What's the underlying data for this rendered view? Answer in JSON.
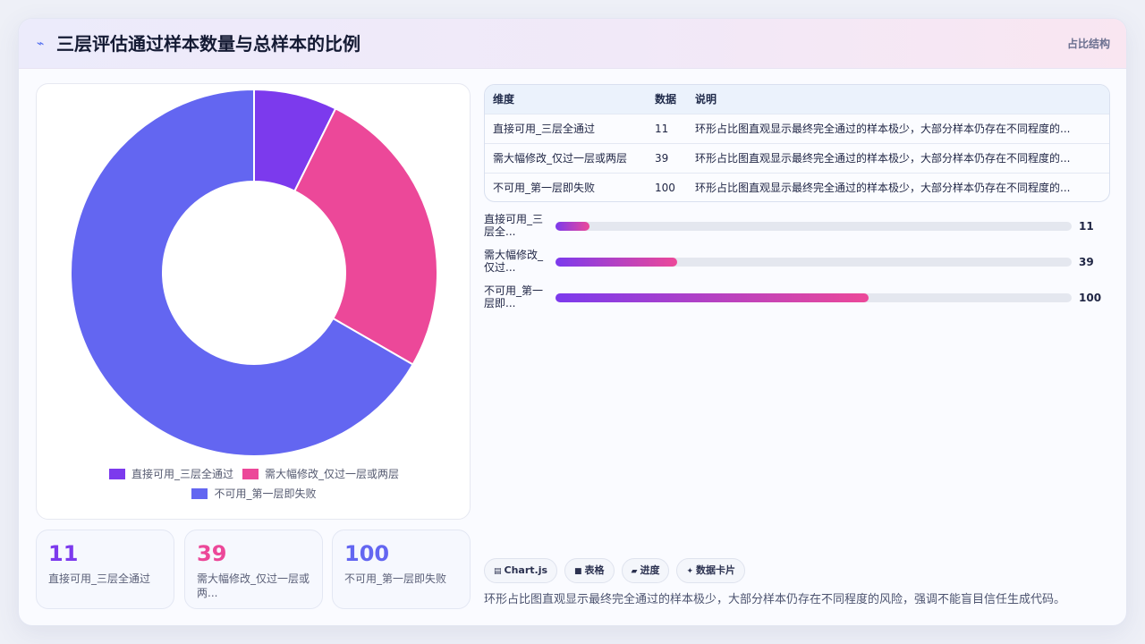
{
  "header": {
    "icon": "sparkle-line-icon",
    "title": "三层评估通过样本数量与总样本的比例",
    "tag": "占比结构"
  },
  "chart_data": {
    "type": "pie",
    "variant": "doughnut",
    "categories": [
      "直接可用_三层全通过",
      "需大幅修改_仅过一层或两层",
      "不可用_第一层即失败"
    ],
    "values": [
      11,
      39,
      100
    ],
    "colors": [
      "#7c3aed",
      "#ec4899",
      "#6366f1"
    ],
    "legend_position": "bottom",
    "title": ""
  },
  "stats": [
    {
      "value": "11",
      "label": "直接可用_三层全通过",
      "color": "#7c3aed"
    },
    {
      "value": "39",
      "label": "需大幅修改_仅过一层或两...",
      "color": "#ec4899"
    },
    {
      "value": "100",
      "label": "不可用_第一层即失败",
      "color": "#6366f1"
    }
  ],
  "table": {
    "headers": [
      "维度",
      "数据",
      "说明"
    ],
    "rows": [
      {
        "name": "直接可用_三层全通过",
        "value": "11",
        "desc": "环形占比图直观显示最终完全通过的样本极少，大部分样本仍存在不同程度的..."
      },
      {
        "name": "需大幅修改_仅过一层或两层",
        "value": "39",
        "desc": "环形占比图直观显示最终完全通过的样本极少，大部分样本仍存在不同程度的..."
      },
      {
        "name": "不可用_第一层即失败",
        "value": "100",
        "desc": "环形占比图直观显示最终完全通过的样本极少，大部分样本仍存在不同程度的..."
      }
    ]
  },
  "progress": {
    "max": 165,
    "items": [
      {
        "label": "直接可用_三层全...",
        "value": 11
      },
      {
        "label": "需大幅修改_仅过...",
        "value": 39
      },
      {
        "label": "不可用_第一层即...",
        "value": 100
      }
    ]
  },
  "chips": [
    {
      "icon": "chart-icon",
      "glyph": "▤",
      "label": "Chart.js"
    },
    {
      "icon": "table-icon",
      "glyph": "■",
      "label": "表格"
    },
    {
      "icon": "progress-icon",
      "glyph": "▰",
      "label": "进度"
    },
    {
      "icon": "data-card-icon",
      "glyph": "✦",
      "label": "数据卡片"
    }
  ],
  "summary": "环形占比图直观显示最终完全通过的样本极少，大部分样本仍存在不同程度的风险，强调不能盲目信任生成代码。"
}
